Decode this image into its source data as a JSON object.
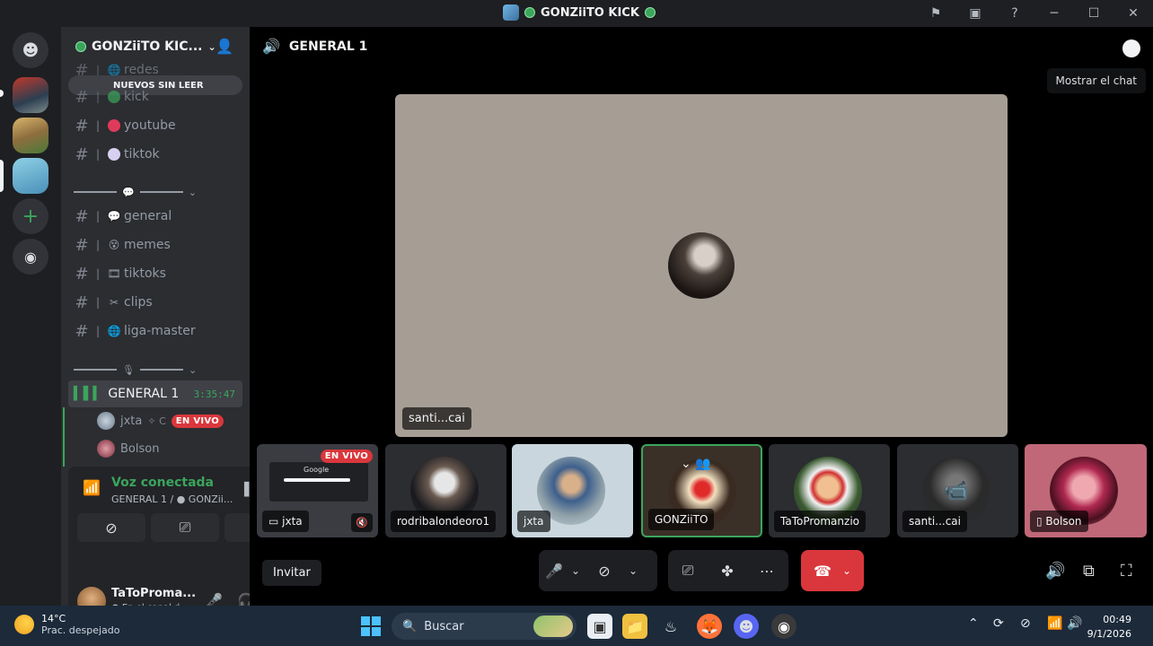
{
  "window": {
    "title": "GONZiiTO KICK",
    "controls": [
      "minimize-icon",
      "maximize-icon",
      "close-icon"
    ]
  },
  "server": {
    "name": "GONZiiTO KIC...",
    "unread_pill": "NUEVOS SIN LEER"
  },
  "channels": {
    "top": [
      {
        "name": "redes",
        "emoji": "globe"
      },
      {
        "name": "kick",
        "emoji": "green-circle"
      },
      {
        "name": "youtube",
        "emoji": "red-circle"
      },
      {
        "name": "tiktok",
        "emoji": "white-circle"
      }
    ],
    "category_a": "💬",
    "chat": [
      {
        "name": "general",
        "emoji": "speech"
      },
      {
        "name": "memes",
        "emoji": "face"
      },
      {
        "name": "tiktoks",
        "emoji": "film"
      },
      {
        "name": "clips",
        "emoji": "scissors"
      },
      {
        "name": "liga-master",
        "emoji": "globe"
      }
    ],
    "category_b": "🎙",
    "voice_channel": {
      "name": "GENERAL 1",
      "timer": "3:35:47",
      "users": [
        {
          "name": "jxta",
          "extra": "✧ C",
          "badge": "EN VIVO"
        },
        {
          "name": "Bolson"
        }
      ]
    }
  },
  "voice_panel": {
    "title": "Voz conectada",
    "subtitle": "GENERAL 1 / ● GONZii...",
    "buttons": [
      "camera-off-icon",
      "screen-share-icon",
      "activities-icon"
    ]
  },
  "user_panel": {
    "name": "TaToProma...",
    "status": "● En el canal d..."
  },
  "stage": {
    "header": "GENERAL 1",
    "tooltip": "Mostrar el chat",
    "main_tile_name": "santi...cai",
    "tiles": [
      {
        "name": "jxta",
        "badge": "EN VIVO",
        "preview_text": "Google"
      },
      {
        "name": "rodribalondeoro1"
      },
      {
        "name": "jxta"
      },
      {
        "name": "GONZiiTO"
      },
      {
        "name": "TaToPromanzio"
      },
      {
        "name": "santi...cai"
      },
      {
        "name": "Bolson"
      }
    ],
    "invite": "Invitar"
  },
  "taskbar": {
    "weather_temp": "14°C",
    "weather_desc": "Prac. despejado",
    "search_placeholder": "Buscar",
    "time": "00:49",
    "date": "9/1/2026"
  },
  "colors": {
    "accent_green": "#3ba55c",
    "danger_red": "#da373c",
    "sidebar": "#2b2d31",
    "rail": "#1e1f22"
  }
}
